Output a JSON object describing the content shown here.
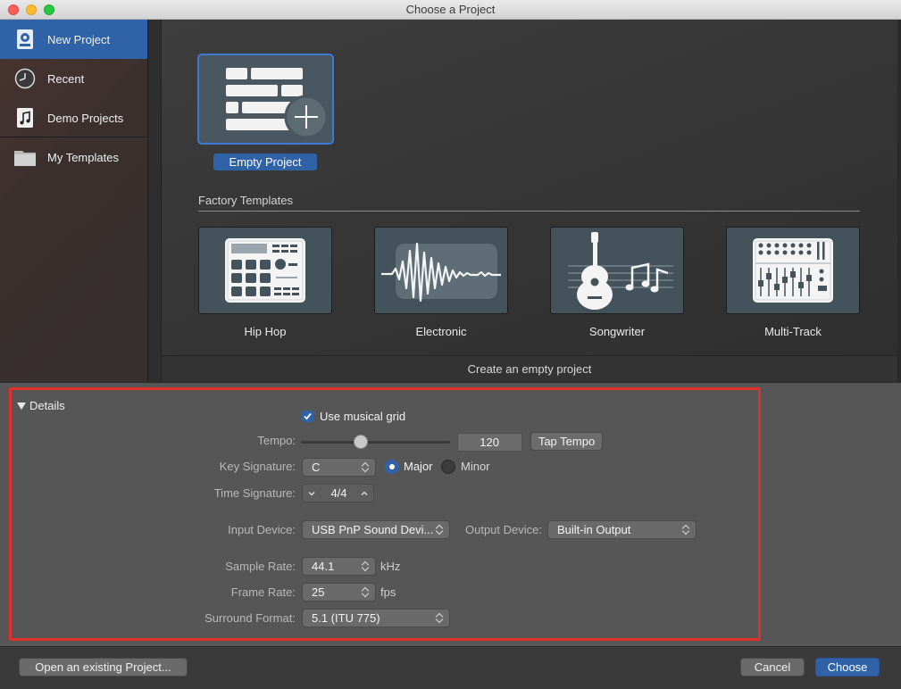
{
  "window": {
    "title": "Choose a Project"
  },
  "sidebar": {
    "items": [
      {
        "label": "New Project",
        "icon": "new-project-icon",
        "selected": true
      },
      {
        "label": "Recent",
        "icon": "clock-icon"
      },
      {
        "label": "Demo Projects",
        "icon": "music-document-icon"
      },
      {
        "label": "My Templates",
        "icon": "folder-icon"
      }
    ]
  },
  "main": {
    "empty_project_label": "Empty Project",
    "factory_templates_title": "Factory Templates",
    "templates": [
      {
        "label": "Hip Hop",
        "icon": "drum-machine-icon"
      },
      {
        "label": "Electronic",
        "icon": "waveform-icon"
      },
      {
        "label": "Songwriter",
        "icon": "guitar-icon"
      },
      {
        "label": "Multi-Track",
        "icon": "mixer-icon"
      }
    ],
    "status_text": "Create an empty project"
  },
  "details": {
    "title": "Details",
    "use_musical_grid": {
      "label": "Use musical grid",
      "checked": true
    },
    "tempo": {
      "label": "Tempo:",
      "value": "120",
      "tap_label": "Tap Tempo",
      "slider_fraction": 0.39
    },
    "key_signature": {
      "label": "Key Signature:",
      "value": "C",
      "major_label": "Major",
      "minor_label": "Minor",
      "mode": "Major"
    },
    "time_signature": {
      "label": "Time Signature:",
      "value": "4/4"
    },
    "input_device": {
      "label": "Input Device:",
      "value": "USB PnP Sound Devi..."
    },
    "output_device": {
      "label": "Output Device:",
      "value": "Built-in Output"
    },
    "sample_rate": {
      "label": "Sample Rate:",
      "value": "44.1",
      "unit": "kHz"
    },
    "frame_rate": {
      "label": "Frame Rate:",
      "value": "25",
      "unit": "fps"
    },
    "surround_format": {
      "label": "Surround Format:",
      "value": "5.1 (ITU 775)"
    }
  },
  "footer": {
    "open_existing_label": "Open an existing Project...",
    "cancel_label": "Cancel",
    "choose_label": "Choose"
  },
  "colors": {
    "accent": "#2f62a7",
    "highlight_border": "#e2302b"
  }
}
